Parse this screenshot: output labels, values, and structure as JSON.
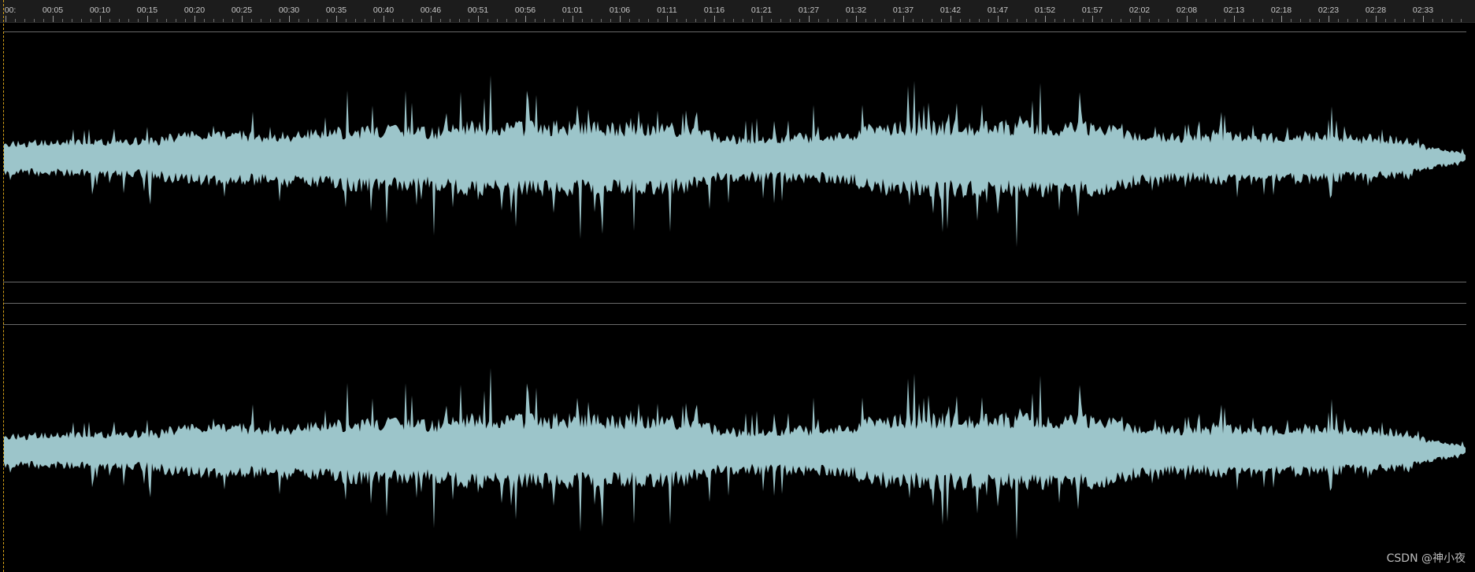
{
  "ruler": {
    "labels": [
      "00:",
      "00:05",
      "00:10",
      "00:15",
      "00:20",
      "00:25",
      "00:30",
      "00:35",
      "00:40",
      "00:46",
      "00:51",
      "00:56",
      "01:01",
      "01:06",
      "01:11",
      "01:16",
      "01:21",
      "01:27",
      "01:32",
      "01:37",
      "01:42",
      "01:47",
      "01:52",
      "01:57",
      "02:02",
      "02:08",
      "02:13",
      "02:18",
      "02:23",
      "02:28",
      "02:33"
    ]
  },
  "waveform": {
    "color": "#9cc5ca",
    "background": "#000000",
    "channels": [
      "left",
      "right"
    ]
  },
  "playhead": {
    "color": "#d4a017"
  },
  "watermark": "CSDN @神小夜"
}
